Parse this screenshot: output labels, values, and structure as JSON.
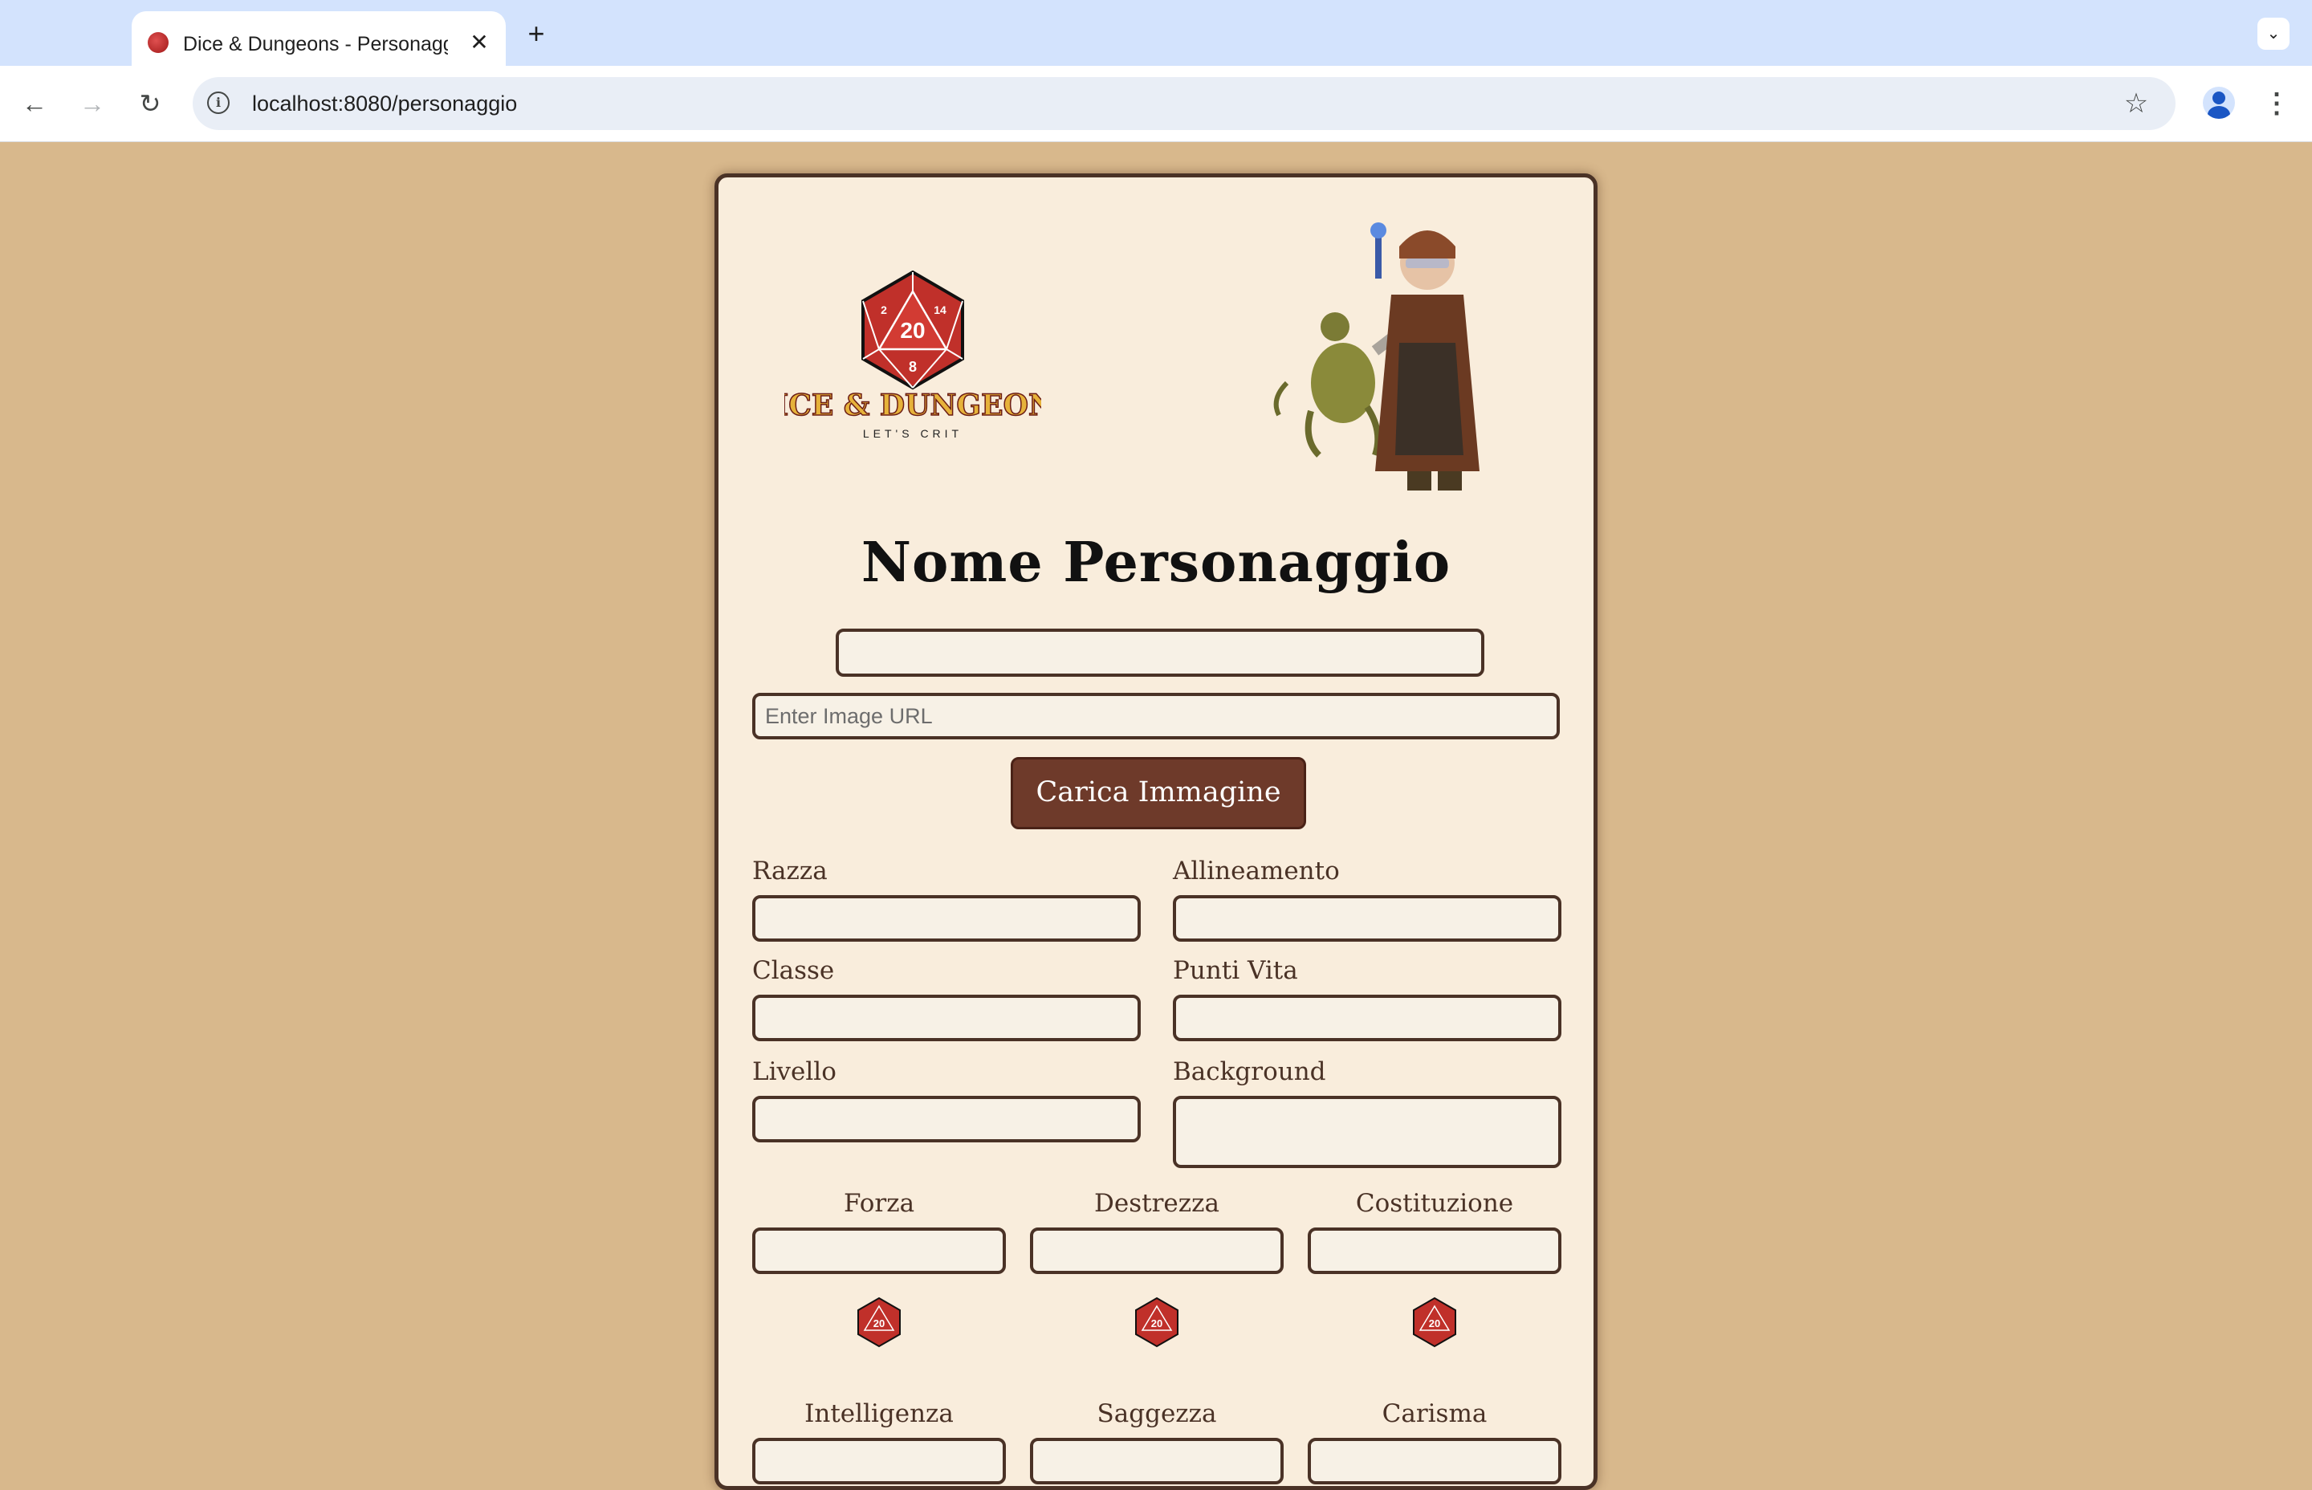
{
  "browser": {
    "tab_title": "Dice & Dungeons - Personaggio",
    "tab_close_icon": "close-icon",
    "new_tab_label": "+",
    "url": "localhost:8080/personaggio"
  },
  "logo": {
    "brand": "DICE & DUNGEONS",
    "tagline": "LET'S CRIT",
    "die_number": "20"
  },
  "page": {
    "title": "Nome Personaggio",
    "name_input_value": "",
    "image_url_placeholder": "Enter Image URL",
    "upload_button": "Carica Immagine"
  },
  "fields": {
    "razza": "Razza",
    "allineamento": "Allineamento",
    "classe": "Classe",
    "punti_vita": "Punti Vita",
    "livello": "Livello",
    "background": "Background"
  },
  "stats": {
    "forza": "Forza",
    "destrezza": "Destrezza",
    "costituzione": "Costituzione",
    "intelligenza": "Intelligenza",
    "saggezza": "Saggezza",
    "carisma": "Carisma"
  },
  "colors": {
    "page_bg": "#d8b88c",
    "card_bg": "#f9eddc",
    "accent_brown": "#4a3226",
    "button_bg": "#6e3a2a",
    "dice_red": "#c0302a"
  }
}
